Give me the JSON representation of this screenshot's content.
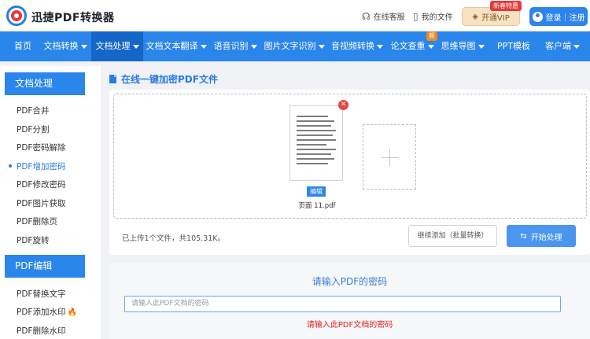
{
  "app": {
    "name": "迅捷PDF转换器"
  },
  "header": {
    "online_service": "在线客服",
    "my_files": "我的文件",
    "vip_label": "开通VIP",
    "vip_badge": "新春特惠",
    "login_label": "登录｜注册"
  },
  "nav": {
    "items": [
      {
        "label": "首页"
      },
      {
        "label": "文档转换"
      },
      {
        "label": "文档处理"
      },
      {
        "label": "文档文本翻译"
      },
      {
        "label": "语音识别"
      },
      {
        "label": "图片文字识别"
      },
      {
        "label": "音视频转换"
      },
      {
        "label": "论文查重"
      },
      {
        "label": "思维导图"
      },
      {
        "label": "PPT模板"
      },
      {
        "label": "客户端"
      }
    ],
    "new_badge": "新",
    "active_index": 2
  },
  "sidebar": {
    "section1": {
      "title": "文档处理",
      "items": [
        "PDF合并",
        "PDF分割",
        "PDF密码解除",
        "PDF增加密码",
        "PDF修改密码",
        "PDF图片获取",
        "PDF删除页",
        "PDF旋转"
      ]
    },
    "section2": {
      "title": "PDF编辑",
      "items": [
        "PDF替换文字",
        "PDF添加水印",
        "PDF删除水印"
      ]
    },
    "active_item": "PDF增加密码"
  },
  "main": {
    "title": "在线一键加密PDF文件",
    "file": {
      "name": "页面 11.pdf",
      "edit_label": "编辑"
    },
    "upload_status": "已上传1个文件，共105.31K。",
    "continue_label": "继续添加（批量转换）",
    "start_label": "开始处理"
  },
  "password": {
    "title": "请输入PDF的密码",
    "placeholder": "请输入此PDF文档的密码",
    "error": "请输入此PDF文档的密码"
  },
  "colors": {
    "brand": "#2a86ea",
    "error": "#e02020"
  }
}
